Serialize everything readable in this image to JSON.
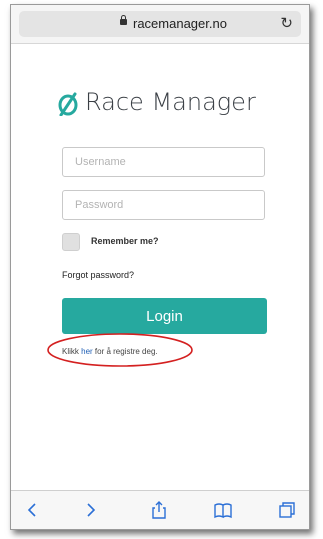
{
  "browser": {
    "url": "racemanager.no",
    "reload_icon": "reload-icon"
  },
  "app": {
    "logo_text": "Race Manager",
    "brand_color": "#26a99f"
  },
  "form": {
    "username_placeholder": "Username",
    "password_placeholder": "Password",
    "remember_label": "Remember me?",
    "forgot_label": "Forgot password?",
    "login_label": "Login",
    "register_prefix": "Klikk ",
    "register_link": "her",
    "register_suffix": " for å registre deg."
  },
  "annotation": {
    "color": "#d42020",
    "shape": "ellipse"
  },
  "toolbar": {
    "icons": [
      "back-icon",
      "forward-icon",
      "share-icon",
      "bookmarks-icon",
      "tabs-icon"
    ]
  }
}
